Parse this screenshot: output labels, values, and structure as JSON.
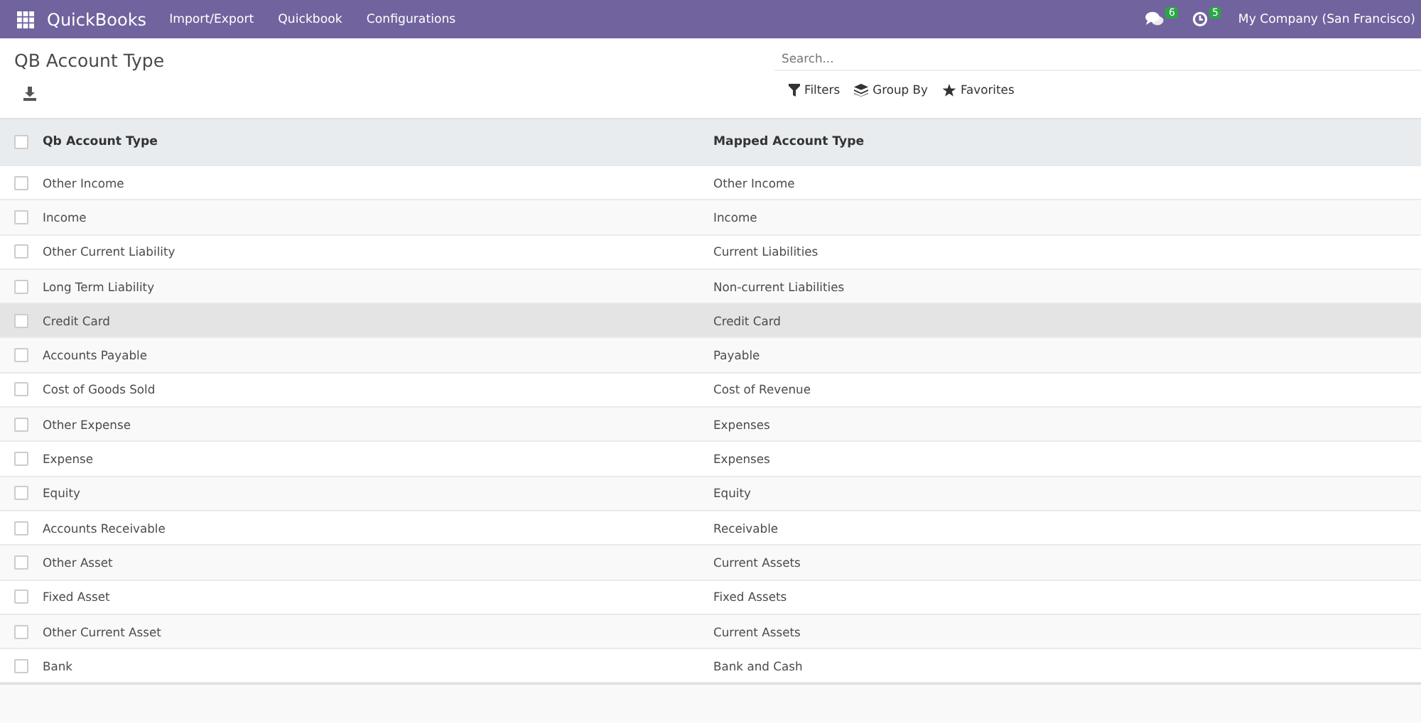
{
  "navbar": {
    "app_name": "QuickBooks",
    "menu": [
      "Import/Export",
      "Quickbook",
      "Configurations"
    ],
    "messages_count": "6",
    "activities_count": "5",
    "company": "My Company (San Francisco)"
  },
  "title": "QB Account Type",
  "search": {
    "placeholder": "Search..."
  },
  "filters": [
    "Filters",
    "Group By",
    "Favorites"
  ],
  "table": {
    "columns": [
      "Qb Account Type",
      "Mapped Account Type"
    ],
    "all_checked": false,
    "rows": [
      {
        "qb_type": "Other Income",
        "mapped_type": "Other Income",
        "checked": false,
        "highlighted": false
      },
      {
        "qb_type": "Income",
        "mapped_type": "Income",
        "checked": false,
        "highlighted": false
      },
      {
        "qb_type": "Other Current Liability",
        "mapped_type": "Current Liabilities",
        "checked": false,
        "highlighted": false
      },
      {
        "qb_type": "Long Term Liability",
        "mapped_type": "Non-current Liabilities",
        "checked": false,
        "highlighted": false
      },
      {
        "qb_type": "Credit Card",
        "mapped_type": "Credit Card",
        "checked": false,
        "highlighted": true
      },
      {
        "qb_type": "Accounts Payable",
        "mapped_type": "Payable",
        "checked": false,
        "highlighted": false
      },
      {
        "qb_type": "Cost of Goods Sold",
        "mapped_type": "Cost of Revenue",
        "checked": false,
        "highlighted": false
      },
      {
        "qb_type": "Other Expense",
        "mapped_type": "Expenses",
        "checked": false,
        "highlighted": false
      },
      {
        "qb_type": "Expense",
        "mapped_type": "Expenses",
        "checked": false,
        "highlighted": false
      },
      {
        "qb_type": "Equity",
        "mapped_type": "Equity",
        "checked": false,
        "highlighted": false
      },
      {
        "qb_type": "Accounts Receivable",
        "mapped_type": "Receivable",
        "checked": false,
        "highlighted": false
      },
      {
        "qb_type": "Other Asset",
        "mapped_type": "Current Assets",
        "checked": false,
        "highlighted": false
      },
      {
        "qb_type": "Fixed Asset",
        "mapped_type": "Fixed Assets",
        "checked": false,
        "highlighted": false
      },
      {
        "qb_type": "Other Current Asset",
        "mapped_type": "Current Assets",
        "checked": false,
        "highlighted": false
      },
      {
        "qb_type": "Bank",
        "mapped_type": "Bank and Cash",
        "checked": false,
        "highlighted": false
      }
    ]
  }
}
